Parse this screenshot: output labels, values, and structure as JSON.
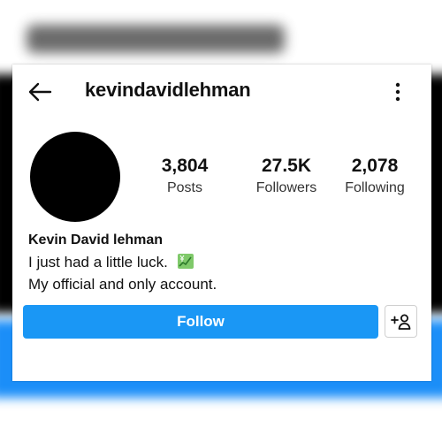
{
  "header": {
    "username": "kevindavidlehman",
    "back_icon": "arrow-left-icon",
    "menu_icon": "vertical-dots-icon"
  },
  "profile": {
    "avatar_color": "#000000",
    "stats": [
      {
        "value": "3,804",
        "label": "Posts"
      },
      {
        "value": "27.5K",
        "label": "Followers"
      },
      {
        "value": "2,078",
        "label": "Following"
      }
    ]
  },
  "bio": {
    "name": "Kevin David lehman",
    "line1": "I just had a little luck.",
    "line1_emoji": "chart-increasing-with-yen-icon",
    "line2": "My official and only account."
  },
  "actions": {
    "follow_label": "Follow",
    "follow_color": "#1a97f5",
    "add_friend_icon": "add-person-icon"
  },
  "background": {
    "frame_top_color": "#000000",
    "frame_bottom_color": "#1b8ef8"
  }
}
